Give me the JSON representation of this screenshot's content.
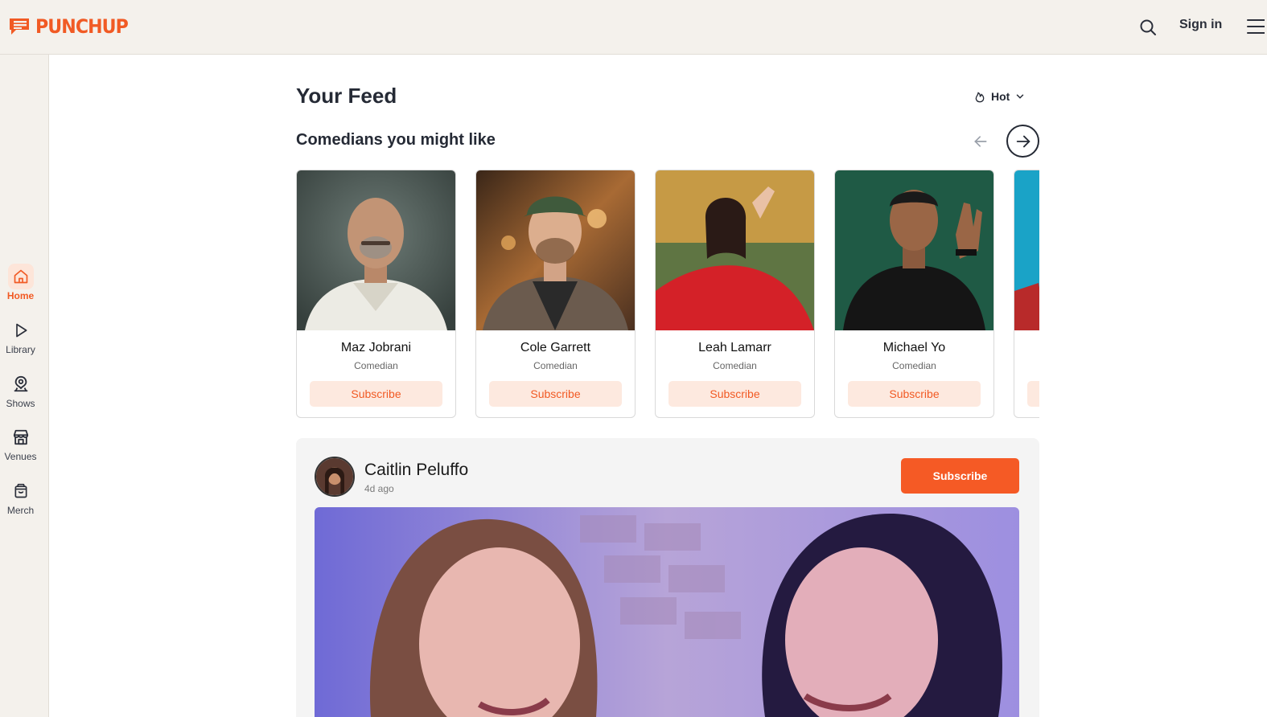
{
  "header": {
    "brand": "PUNCHUP",
    "signin_label": "Sign in",
    "icons": {
      "search": "search-icon",
      "menu": "hamburger-menu-icon",
      "logo": "speech-flag-logo-icon"
    }
  },
  "sidebar": {
    "items": [
      {
        "label": "Home",
        "icon": "home-icon",
        "active": true
      },
      {
        "label": "Library",
        "icon": "play-icon",
        "active": false
      },
      {
        "label": "Shows",
        "icon": "map-pin-person-icon",
        "active": false
      },
      {
        "label": "Venues",
        "icon": "storefront-icon",
        "active": false
      },
      {
        "label": "Merch",
        "icon": "shopping-bag-icon",
        "active": false
      }
    ]
  },
  "feed": {
    "title": "Your Feed",
    "sort_label": "Hot",
    "sort_icon": "flame-icon"
  },
  "suggestions": {
    "title": "Comedians you might like",
    "cards": [
      {
        "name": "Maz Jobrani",
        "role": "Comedian",
        "button": "Subscribe"
      },
      {
        "name": "Cole Garrett",
        "role": "Comedian",
        "button": "Subscribe"
      },
      {
        "name": "Leah Lamarr",
        "role": "Comedian",
        "button": "Subscribe"
      },
      {
        "name": "Michael Yo",
        "role": "Comedian",
        "button": "Subscribe"
      }
    ]
  },
  "post": {
    "author": "Caitlin Peluffo",
    "time": "4d ago",
    "button": "Subscribe"
  },
  "colors": {
    "brand": "#f15a24",
    "sidebar_bg": "#f4f1ec",
    "subscribe_soft_bg": "#fde9df",
    "subscribe_solid_bg": "#f55a25"
  }
}
